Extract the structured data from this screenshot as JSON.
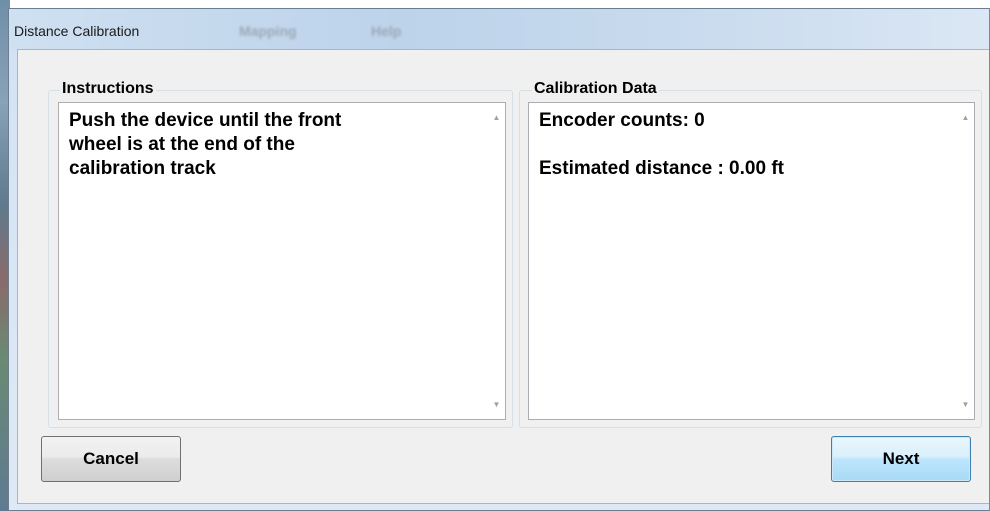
{
  "window": {
    "title": "Distance Calibration",
    "background_menu": [
      "Mapping",
      "Help"
    ]
  },
  "instructions": {
    "label": "Instructions",
    "lines": [
      "Push the device until the front",
      "wheel is at the end of the",
      "calibration track"
    ]
  },
  "calibration_data": {
    "label": "Calibration Data",
    "encoder_counts": "Encoder counts: 0",
    "estimated_distance": "Estimated distance : 0.00 ft"
  },
  "buttons": {
    "cancel": "Cancel",
    "next": "Next"
  },
  "icons": {
    "scroll_up": "scroll-up-arrow-icon",
    "scroll_down": "scroll-down-arrow-icon"
  },
  "colors": {
    "dialog_background": "#f0f0f0",
    "title_bar": "#c8dcf0",
    "default_button": "#bee6fd"
  }
}
